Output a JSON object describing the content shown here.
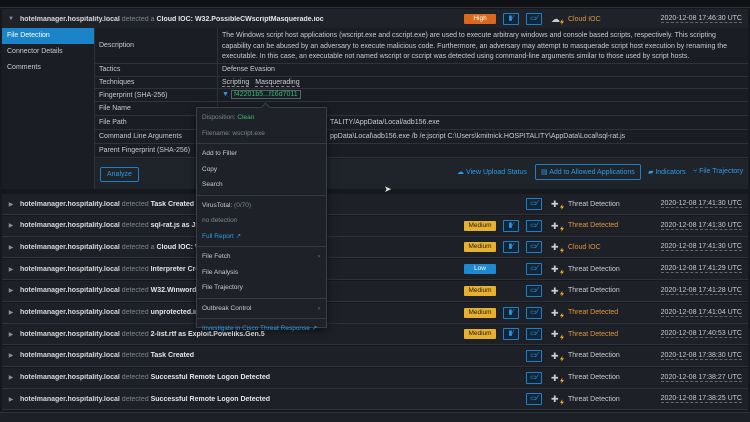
{
  "main_event": {
    "host": "hotelmanager.hospitality.local",
    "verb": "detected a",
    "title": "Cloud IOC: W32.PossibleCWscriptMasquerade.ioc",
    "severity": "High",
    "category": "Cloud IOC",
    "time": "2020-12-08 17:46:30 UTC"
  },
  "nav": [
    "File Detection",
    "Connector Details",
    "Comments"
  ],
  "details": {
    "description_label": "Description",
    "description": "The Windows script host applications (wscript.exe and cscript.exe) are used to execute arbitrary windows and console based scripts, respectively. This scripting capability can be abused by an adversary to execute malicious code. Furthermore, an adversary may attempt to masquerade script host execution by renaming the executable. In this case, an executable not named wscript or cscript was detected using command-line arguments similar to those used by script hosts.",
    "tactics_label": "Tactics",
    "tactics": "Defense Evasion",
    "techniques_label": "Techniques",
    "techniques": [
      "Scripting",
      "Masquerading"
    ],
    "fingerprint_label": "Fingerprint (SHA-256)",
    "fingerprint": "f42201b5...f16d7011",
    "file_name_label": "File Name",
    "file_path_label": "File Path",
    "file_path": "TALITY/AppData/Local/adb156.exe",
    "cmd_label": "Command Line Arguments",
    "cmd": "ppData\\Local\\adb156.exe /b /e:jscript C:\\Users\\kmitnick.HOSPITALITY\\AppData\\Local\\sql-rat.js",
    "parent_label": "Parent Fingerprint (SHA-256)"
  },
  "actions": {
    "analyze": "Analyze",
    "upload": "View Upload Status",
    "allow": "Add to Allowed Applications",
    "indicators": "Indicators",
    "trajectory": "File Trajectory"
  },
  "popup": {
    "disposition_label": "Disposition:",
    "disposition": "Clean",
    "filename": "Filename: wscript.exe",
    "add_filter": "Add to Filter",
    "copy": "Copy",
    "search": "Search",
    "vt_label": "VirusTotal:",
    "vt": "(0/70)",
    "no_detection": "no detection",
    "full_report": "Full Report",
    "file_fetch": "File Fetch",
    "file_analysis": "File Analysis",
    "file_trajectory": "File Trajectory",
    "outbreak": "Outbreak Control",
    "investigate": "Investigate in Cisco Threat Response"
  },
  "events": [
    {
      "host": "hotelmanager.hospitality.local",
      "verb": "detected",
      "pre": "",
      "title": "Task Created",
      "severity": "",
      "file": false,
      "category": "Threat Detection",
      "orange": false,
      "time": "2020-12-08 17:41:30 UTC"
    },
    {
      "host": "hotelmanager.hospitality.local",
      "verb": "detected",
      "pre": "sql-rat.js",
      "title": "as JS",
      "severity": "Medium",
      "file": true,
      "category": "Threat Detected",
      "orange": true,
      "time": "2020-12-08 17:41:30 UTC"
    },
    {
      "host": "hotelmanager.hospitality.local",
      "verb": "detected a",
      "pre": "",
      "title": "Cloud IOC: W",
      "severity": "Medium",
      "file": true,
      "category": "Cloud IOC",
      "orange": true,
      "time": "2020-12-08 17:41:30 UTC"
    },
    {
      "host": "hotelmanager.hospitality.local",
      "verb": "detected",
      "pre": "",
      "title": "Interpreter Cre",
      "severity": "Low",
      "file": false,
      "category": "Threat Detection",
      "orange": false,
      "time": "2020-12-08 17:41:29 UTC"
    },
    {
      "host": "hotelmanager.hospitality.local",
      "verb": "detected",
      "pre": "",
      "title": "W32.Winwordl",
      "severity": "Medium",
      "file": false,
      "category": "Threat Detection",
      "orange": false,
      "time": "2020-12-08 17:41:28 UTC"
    },
    {
      "host": "hotelmanager.hospitality.local",
      "verb": "detected",
      "pre": "",
      "title": "unprotected.ir",
      "severity": "Medium",
      "file": true,
      "category": "Threat Detected",
      "orange": true,
      "time": "2020-12-08 17:41:04 UTC"
    },
    {
      "host": "hotelmanager.hospitality.local",
      "verb": "detected",
      "pre": "2-list.rtf",
      "title": "as Exploit.Poweliks.Gen.5",
      "severity": "Medium",
      "file": true,
      "category": "Threat Detected",
      "orange": true,
      "time": "2020-12-08 17:40:53 UTC"
    },
    {
      "host": "hotelmanager.hospitality.local",
      "verb": "detected",
      "pre": "",
      "title": "Task Created",
      "severity": "",
      "file": false,
      "category": "Threat Detection",
      "orange": false,
      "time": "2020-12-08 17:38:30 UTC"
    },
    {
      "host": "hotelmanager.hospitality.local",
      "verb": "detected",
      "pre": "",
      "title": "Successful Remote Logon Detected",
      "severity": "",
      "file": false,
      "category": "Threat Detection",
      "orange": false,
      "time": "2020-12-08 17:38:27 UTC"
    },
    {
      "host": "hotelmanager.hospitality.local",
      "verb": "detected",
      "pre": "",
      "title": "Successful Remote Logon Detected",
      "severity": "",
      "file": false,
      "category": "Threat Detection",
      "orange": false,
      "time": "2020-12-08 17:38:25 UTC"
    }
  ]
}
